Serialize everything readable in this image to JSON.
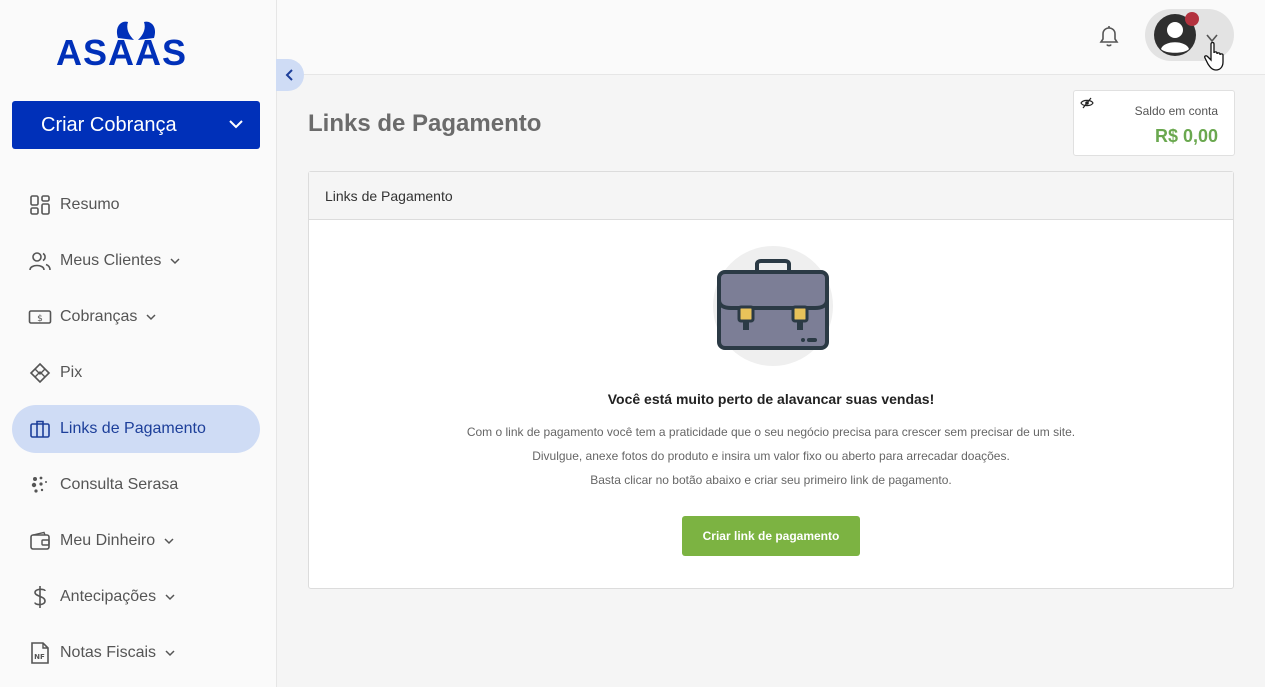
{
  "brand": {
    "logo_text": "ASAAS",
    "color": "#0030b9"
  },
  "sidebar": {
    "create_button": "Criar Cobrança",
    "items": [
      {
        "label": "Resumo",
        "icon": "dashboard-icon",
        "has_caret": false,
        "active": false
      },
      {
        "label": "Meus Clientes",
        "icon": "users-icon",
        "has_caret": true,
        "active": false
      },
      {
        "label": "Cobranças",
        "icon": "money-icon",
        "has_caret": true,
        "active": false
      },
      {
        "label": "Pix",
        "icon": "pix-icon",
        "has_caret": false,
        "active": false
      },
      {
        "label": "Links de Pagamento",
        "icon": "briefcase-icon",
        "has_caret": false,
        "active": true
      },
      {
        "label": "Consulta Serasa",
        "icon": "serasa-icon",
        "has_caret": false,
        "active": false
      },
      {
        "label": "Meu Dinheiro",
        "icon": "wallet-icon",
        "has_caret": true,
        "active": false
      },
      {
        "label": "Antecipações",
        "icon": "dollar-icon",
        "has_caret": true,
        "active": false
      },
      {
        "label": "Notas Fiscais",
        "icon": "invoice-icon",
        "has_caret": true,
        "active": false
      }
    ]
  },
  "header": {
    "notification_dot_color": "#b3323e"
  },
  "main": {
    "title": "Links de Pagamento",
    "balance": {
      "label": "Saldo em conta",
      "value": "R$ 0,00"
    },
    "card": {
      "header": "Links de Pagamento",
      "headline": "Você está muito perto de alavancar suas vendas!",
      "lines": [
        "Com o link de pagamento você tem a praticidade que o seu negócio precisa para crescer sem precisar de um site.",
        "Divulgue, anexe fotos do produto e insira um valor fixo ou aberto para arrecadar doações.",
        "Basta clicar no botão abaixo e criar seu primeiro link de pagamento."
      ],
      "cta": "Criar link de pagamento"
    }
  }
}
